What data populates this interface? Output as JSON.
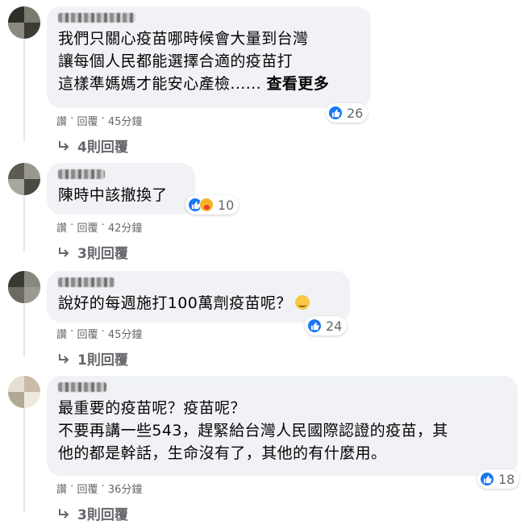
{
  "comments": [
    {
      "lines": [
        "我們只關心疫苗哪時候會大量到台灣",
        "讓每個人民都能選擇合適的疫苗打",
        "這樣準媽媽才能安心產檢......"
      ],
      "see_more": "查看更多",
      "reaction_count": "26",
      "like": "讚",
      "sep1": "·",
      "reply": "回覆",
      "sep2": "·",
      "time": "45分鐘",
      "replies": "4則回覆"
    },
    {
      "lines": [
        "陳時中該撤換了"
      ],
      "reaction_count": "10",
      "like": "讚",
      "sep1": "·",
      "reply": "回覆",
      "sep2": "·",
      "time": "42分鐘",
      "replies": "3則回覆"
    },
    {
      "lines": [
        "說好的每週施打100萬劑疫苗呢？"
      ],
      "reaction_count": "24",
      "like": "讚",
      "sep1": "·",
      "reply": "回覆",
      "sep2": "·",
      "time": "45分鐘",
      "replies": "1則回覆"
    },
    {
      "lines": [
        "最重要的疫苗呢？疫苗呢？",
        "不要再講一些543，趕緊給台灣人民國際認證的疫苗，其",
        "他的都是幹話，生命沒有了，其他的有什麼用。"
      ],
      "reaction_count": "18",
      "like": "讚",
      "sep1": "·",
      "reply": "回覆",
      "sep2": "·",
      "time": "36分鐘",
      "replies": "3則回覆"
    }
  ],
  "colors": {
    "bubble": "#f0f2f5",
    "meta": "#65676b",
    "like_blue": "#1877f2"
  },
  "icons": [
    "like-icon",
    "care-icon",
    "emoji-icon",
    "reply-arrow-icon"
  ]
}
